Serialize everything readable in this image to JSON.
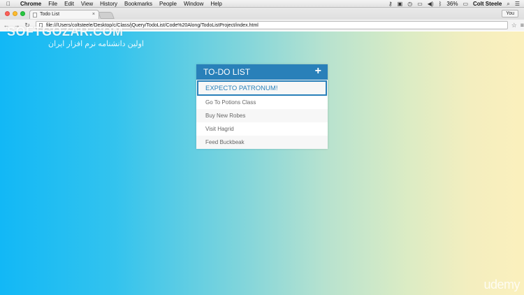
{
  "menubar": {
    "app": "Chrome",
    "items": [
      "File",
      "Edit",
      "View",
      "History",
      "Bookmarks",
      "People",
      "Window",
      "Help"
    ],
    "battery": "36%",
    "user": "Colt Steele"
  },
  "browser": {
    "tab_title": "Todo List",
    "tab_close": "×",
    "profile": "You",
    "url": "file:///Users/coltsteele/Desktop/c/Class/jQuery/TodoList/Code%20Along/TodoListProject/index.html"
  },
  "watermark": {
    "title": "SOFTGOZAR.COM",
    "subtitle": "اولین دانشنامه نرم افزار ایران"
  },
  "todo": {
    "title": "TO-DO LIST",
    "add_symbol": "+",
    "input_value": "EXPECTO PATRONUM!",
    "items": [
      "Go To Potions Class",
      "Buy New Robes",
      "Visit Hagrid",
      "Feed Buckbeak"
    ]
  },
  "branding": {
    "udemy": "udemy"
  },
  "colors": {
    "accent": "#2980b9"
  }
}
